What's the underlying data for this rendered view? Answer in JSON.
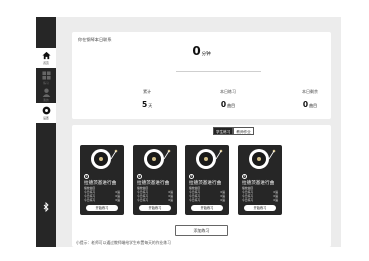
{
  "sidebar": {
    "items": [
      {
        "label": "首页",
        "icon": "home-icon"
      },
      {
        "label": "练习",
        "icon": "grid-icon"
      },
      {
        "label": "我的",
        "icon": "user-icon"
      },
      {
        "label": "设置",
        "icon": "record-icon"
      }
    ],
    "active_index": 0,
    "bottom_icon": "bluetooth-icon"
  },
  "summary": {
    "title": "你在钢琴本日联系",
    "today_value": "0",
    "today_unit": "分钟",
    "stats": [
      {
        "label": "累计",
        "value": "5",
        "unit": "天"
      },
      {
        "label": "本日练习",
        "value": "0",
        "unit": "曲目"
      },
      {
        "label": "本日剩余",
        "value": "0",
        "unit": "曲目"
      }
    ]
  },
  "tabs": [
    {
      "label": "学生练习",
      "active": true
    },
    {
      "label": "教师作业",
      "active": false
    }
  ],
  "cards": [
    {
      "badge": "1",
      "title": "拉德茨基进行曲",
      "rows": [
        {
          "l": "播放曲目",
          "r": ""
        },
        {
          "l": "今日练习",
          "r": "0遍"
        },
        {
          "l": "今日练习",
          "r": "0遍"
        },
        {
          "l": "今日练习",
          "r": "0遍"
        }
      ],
      "button": "开始练习"
    },
    {
      "badge": "2",
      "title": "拉德茨基进行曲",
      "rows": [
        {
          "l": "播放曲目",
          "r": ""
        },
        {
          "l": "今日练习",
          "r": "0遍"
        },
        {
          "l": "今日练习",
          "r": "0遍"
        },
        {
          "l": "今日练习",
          "r": "0遍"
        }
      ],
      "button": "开始练习"
    },
    {
      "badge": "3",
      "title": "拉德茨基进行曲",
      "rows": [
        {
          "l": "播放曲目",
          "r": ""
        },
        {
          "l": "今日练习",
          "r": "0遍"
        },
        {
          "l": "今日练习",
          "r": "0遍"
        },
        {
          "l": "今日练习",
          "r": "0遍"
        }
      ],
      "button": "开始练习"
    },
    {
      "badge": "4",
      "title": "拉德茨基进行曲",
      "rows": [
        {
          "l": "播放曲目",
          "r": ""
        },
        {
          "l": "今日练习",
          "r": "0遍"
        },
        {
          "l": "今日练习",
          "r": "0遍"
        },
        {
          "l": "今日练习",
          "r": "0遍"
        }
      ],
      "button": "开始练习"
    }
  ],
  "add_button": "添加练习",
  "tip": "小提示：老师可以通过教师端给学生布置每天的作业练习",
  "colors": {
    "sidebar": "#262626",
    "card": "#262626",
    "accent": "#d4c08a",
    "page_bg": "#ececec"
  }
}
